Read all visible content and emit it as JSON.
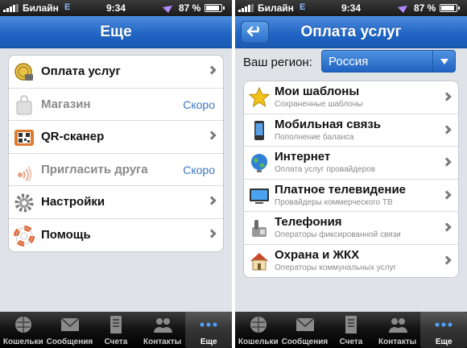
{
  "status_bar": {
    "carrier": "Билайн",
    "network": "E",
    "time": "9:34",
    "battery": "87 %"
  },
  "left_screen": {
    "title": "Еще",
    "items": [
      {
        "label": "Оплата услуг",
        "icon": "coin-payment-icon",
        "soon": ""
      },
      {
        "label": "Магазин",
        "icon": "shopping-bag-icon",
        "soon": "Скоро"
      },
      {
        "label": "QR-сканер",
        "icon": "qr-scanner-icon",
        "soon": ""
      },
      {
        "label": "Пригласить друга",
        "icon": "invite-friend-icon",
        "soon": "Скоро"
      },
      {
        "label": "Настройки",
        "icon": "gear-icon",
        "soon": ""
      },
      {
        "label": "Помощь",
        "icon": "lifebuoy-icon",
        "soon": ""
      }
    ]
  },
  "right_screen": {
    "title": "Оплата услуг",
    "region_label": "Ваш регион:",
    "region_value": "Россия",
    "items": [
      {
        "label": "Мои шаблоны",
        "sub": "Сохраненные шаблоны",
        "icon": "star-icon"
      },
      {
        "label": "Мобильная связь",
        "sub": "Пополнение баланса",
        "icon": "mobile-phone-icon"
      },
      {
        "label": "Интернет",
        "sub": "Оплата услуг провайдеров",
        "icon": "globe-icon"
      },
      {
        "label": "Платное телевидение",
        "sub": "Провайдеры коммерческого ТВ",
        "icon": "tv-icon"
      },
      {
        "label": "Телефония",
        "sub": "Операторы фиксированной связи",
        "icon": "landline-phone-icon"
      },
      {
        "label": "Охрана и ЖКХ",
        "sub": "Операторы коммунальных услуг",
        "icon": "house-icon"
      }
    ]
  },
  "tabbar": {
    "tabs": [
      {
        "label": "Кошельки",
        "icon": "wallet-globe-icon"
      },
      {
        "label": "Сообщения",
        "icon": "envelope-icon"
      },
      {
        "label": "Счета",
        "icon": "invoice-icon"
      },
      {
        "label": "Контакты",
        "icon": "contacts-icon"
      },
      {
        "label": "Еще",
        "icon": "more-dots-icon"
      }
    ],
    "active_index": 4
  },
  "colors": {
    "nav_blue": "#1f63c2",
    "link_blue": "#3b78c7",
    "background": "#dfe2e7"
  }
}
